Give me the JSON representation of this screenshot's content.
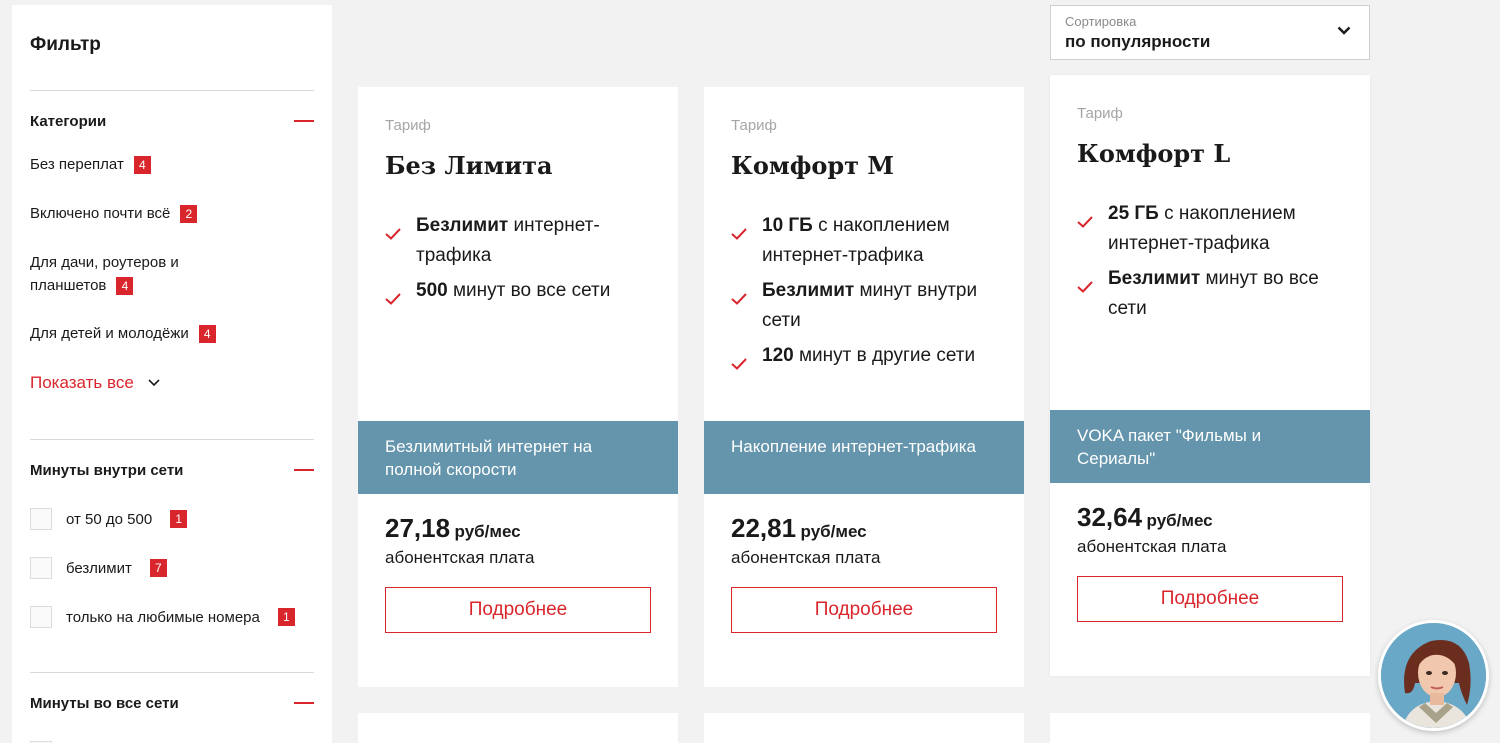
{
  "filter": {
    "title": "Фильтр",
    "categories": {
      "heading": "Категории",
      "items": [
        {
          "label": "Без переплат",
          "count": "4"
        },
        {
          "label": "Включено почти всё",
          "count": "2"
        },
        {
          "label_line1": "Для дачи, роутеров и",
          "label_line2": "планшетов",
          "count": "4"
        },
        {
          "label": "Для детей и молодёжи",
          "count": "4"
        }
      ],
      "show_all": "Показать все"
    },
    "minutes_inside": {
      "heading": "Минуты внутри сети",
      "options": [
        {
          "label": "от 50 до 500",
          "count": "1"
        },
        {
          "label": "безлимит",
          "count": "7"
        },
        {
          "label": "только на любимые номера",
          "count": "1"
        }
      ]
    },
    "minutes_all": {
      "heading": "Минуты во все сети"
    }
  },
  "sort": {
    "label": "Сортировка",
    "value": "по популярности"
  },
  "cards": [
    {
      "label": "Тариф",
      "title": "Без Лимита",
      "features": [
        {
          "bold": "Безлимит",
          "text": " интернет-трафика"
        },
        {
          "bold": "500",
          "text": " минут во все сети"
        }
      ],
      "band": "Безлимитный интернет на полной скорости",
      "price": "27,18",
      "unit": "руб/мес",
      "price_sub": "абонентская плата",
      "button": "Подробнее"
    },
    {
      "label": "Тариф",
      "title": "Комфорт М",
      "features": [
        {
          "bold": "10 ГБ",
          "text": " с накоплением интернет-трафика"
        },
        {
          "bold": "Безлимит",
          "text": " минут внутри сети"
        },
        {
          "bold": "120",
          "text": " минут в другие сети"
        }
      ],
      "band": "Накопление интернет-трафика",
      "price": "22,81",
      "unit": "руб/мес",
      "price_sub": "абонентская плата",
      "button": "Подробнее"
    },
    {
      "label": "Тариф",
      "title": "Комфорт L",
      "features": [
        {
          "bold": "25 ГБ",
          "text": " с накоплением интернет-трафика"
        },
        {
          "bold": "Безлимит",
          "text": " минут во все сети"
        }
      ],
      "band": "VOKA пакет \"Фильмы и Сериалы\"",
      "price": "32,64",
      "unit": "руб/мес",
      "price_sub": "абонентская плата",
      "button": "Подробнее"
    }
  ],
  "colors": {
    "accent": "#d9262c",
    "band": "#6495ac",
    "background": "#f2f2f2"
  },
  "icons": [
    "minus-icon",
    "chevron-down-icon",
    "check-icon",
    "assistant-avatar"
  ]
}
